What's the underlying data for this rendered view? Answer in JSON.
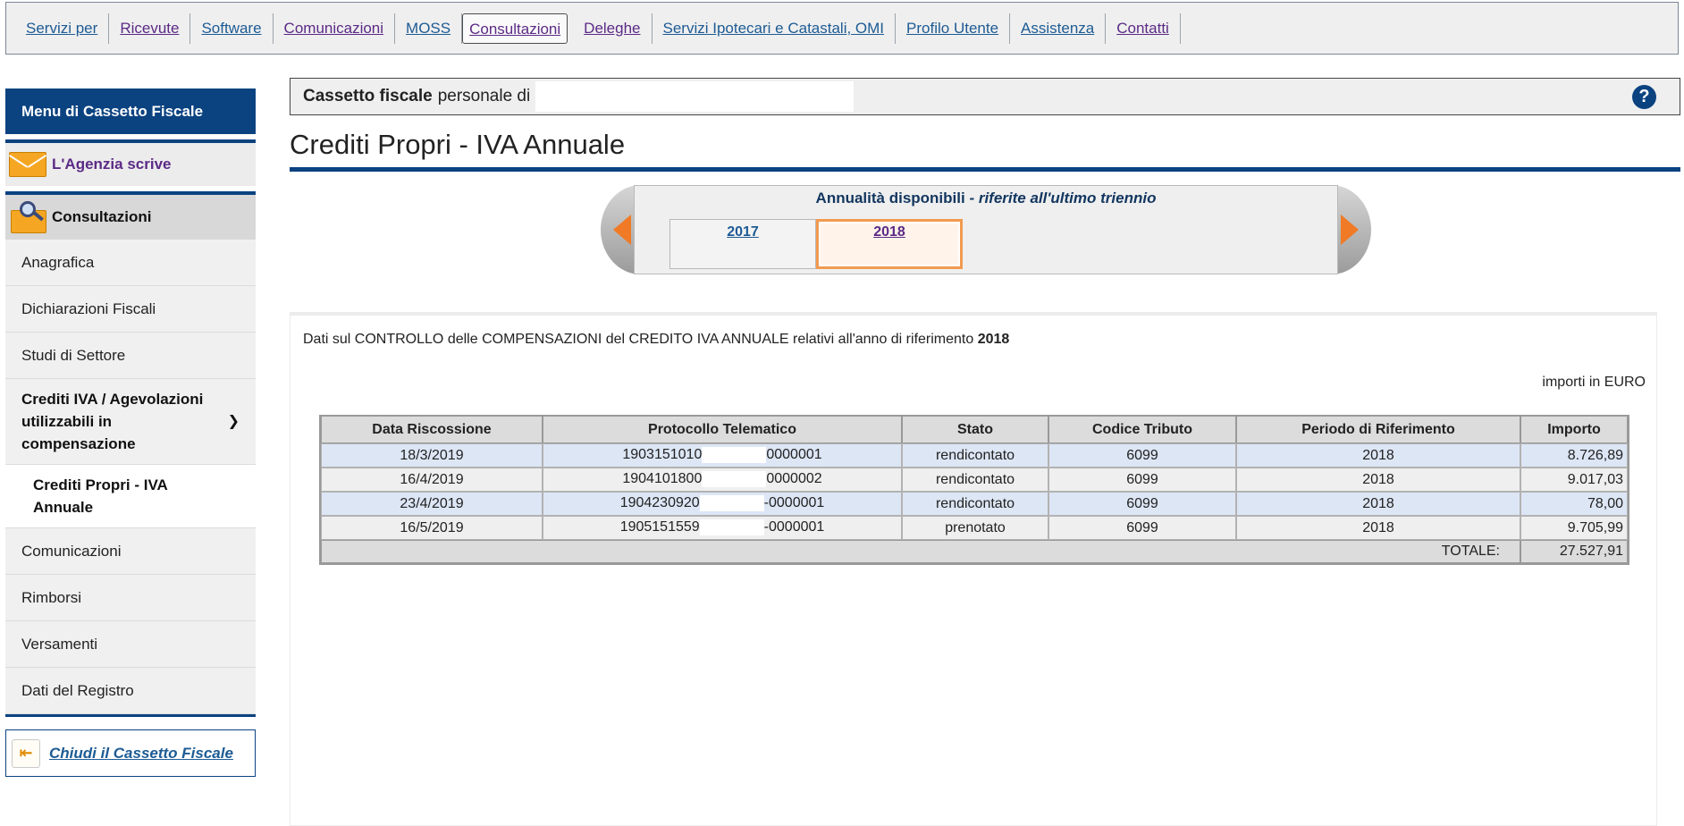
{
  "topnav": {
    "items": [
      {
        "label": "Servizi per"
      },
      {
        "label": "Ricevute"
      },
      {
        "label": "Software"
      },
      {
        "label": "Comunicazioni"
      },
      {
        "label": "MOSS"
      },
      {
        "label": "Consultazioni"
      },
      {
        "label": "Deleghe"
      },
      {
        "label": "Servizi Ipotecari e Catastali, OMI"
      },
      {
        "label": "Profilo Utente"
      },
      {
        "label": "Assistenza"
      },
      {
        "label": "Contatti"
      }
    ]
  },
  "sidebar": {
    "header": "Menu di Cassetto Fiscale",
    "agenzia": "L'Agenzia scrive",
    "consultazioni": "Consultazioni",
    "items": [
      {
        "label": "Anagrafica"
      },
      {
        "label": "Dichiarazioni Fiscali"
      },
      {
        "label": "Studi di Settore"
      },
      {
        "label": "Crediti IVA / Agevolazioni utilizzabili in compensazione"
      },
      {
        "label": "Crediti Propri - IVA Annuale"
      },
      {
        "label": "Comunicazioni"
      },
      {
        "label": "Rimborsi"
      },
      {
        "label": "Versamenti"
      },
      {
        "label": "Dati del Registro"
      }
    ],
    "close_label": "Chiudi il Cassetto Fiscale"
  },
  "header": {
    "bold": "Cassetto fiscale",
    "rest": "personale di",
    "help": "?"
  },
  "page": {
    "title": "Crediti Propri - IVA Annuale"
  },
  "years": {
    "title": "Annualità disponibili",
    "subtitle": " - riferite all'ultimo triennio",
    "items": [
      "2017",
      "2018"
    ],
    "selected": "2018"
  },
  "content": {
    "intro": "Dati sul CONTROLLO delle COMPENSAZIONI del CREDITO IVA ANNUALE relativi all'anno di riferimento",
    "intro_year": "2018",
    "unit": "importi in EURO"
  },
  "table": {
    "columns": [
      "Data Riscossione",
      "Protocollo Telematico",
      "Stato",
      "Codice Tributo",
      "Periodo di Riferimento",
      "Importo"
    ],
    "rows": [
      {
        "data": "18/3/2019",
        "prot_a": "1903151010",
        "prot_b": "0000001",
        "stato": "rendicontato",
        "codice": "6099",
        "periodo": "2018",
        "importo": "8.726,89"
      },
      {
        "data": "16/4/2019",
        "prot_a": "1904101800",
        "prot_b": "0000002",
        "stato": "rendicontato",
        "codice": "6099",
        "periodo": "2018",
        "importo": "9.017,03"
      },
      {
        "data": "23/4/2019",
        "prot_a": "1904230920",
        "prot_b": "-0000001",
        "stato": "rendicontato",
        "codice": "6099",
        "periodo": "2018",
        "importo": "78,00"
      },
      {
        "data": "16/5/2019",
        "prot_a": "1905151559",
        "prot_b": "-0000001",
        "stato": "prenotato",
        "codice": "6099",
        "periodo": "2018",
        "importo": "9.705,99"
      }
    ],
    "total_label": "TOTALE:",
    "total_value": "27.527,91"
  },
  "colors": {
    "brand_blue": "#0b4280",
    "link_blue": "#1d5b94",
    "visited_purple": "#5b2a86",
    "accent_orange": "#f07a25",
    "row_highlight": "#dde6f5"
  }
}
